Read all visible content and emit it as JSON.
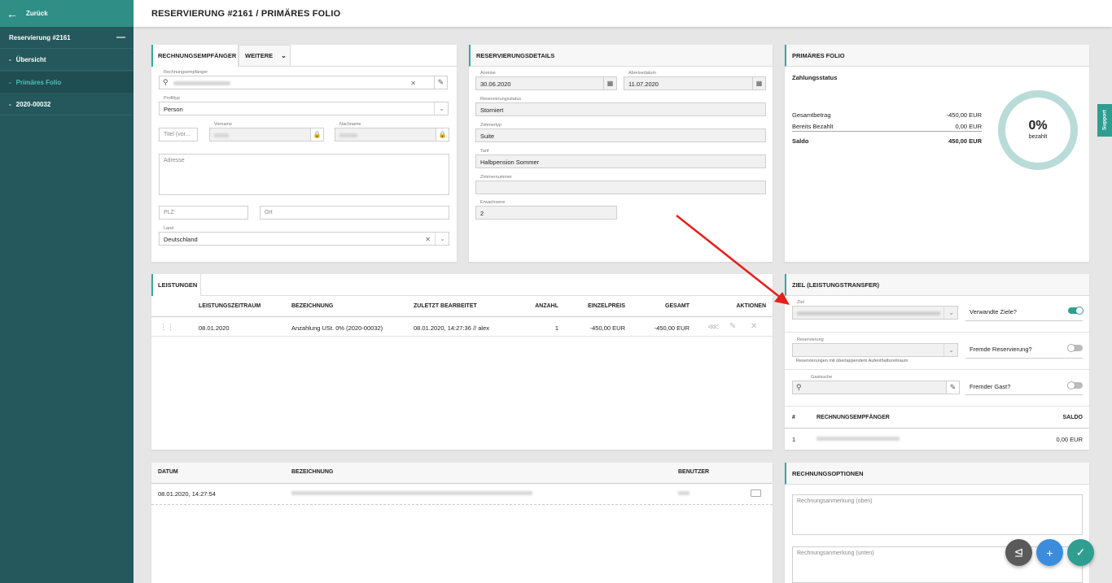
{
  "sidebar": {
    "back_label": "Zurück",
    "section_label": "Reservierung #2161",
    "items": [
      {
        "label": "Übersicht"
      },
      {
        "label": "Primäres Folio"
      },
      {
        "label": "2020-00032"
      }
    ]
  },
  "header": {
    "title": "RESERVIERUNG #2161 / PRIMÄRES FOLIO"
  },
  "recipient": {
    "tab_active": "RECHNUNGSEMPFÄNGER",
    "tab_more": "WEITERE",
    "fields": {
      "rechnungsempfaenger": {
        "label": "Rechnungsempfänger"
      },
      "profiltyp": {
        "label": "Profiltyp",
        "value": "Person"
      },
      "titel": {
        "placeholder": "Titel (vor..."
      },
      "vorname": {
        "label": "Vorname"
      },
      "nachname": {
        "label": "Nachname"
      },
      "adresse": {
        "placeholder": "Adresse"
      },
      "plz": {
        "placeholder": "PLZ"
      },
      "ort": {
        "placeholder": "Ort"
      },
      "land": {
        "label": "Land",
        "value": "Deutschland"
      }
    }
  },
  "details": {
    "title": "RESERVIERUNGSDETAILS",
    "anreise": {
      "label": "Anreise",
      "value": "30.06.2020"
    },
    "abreise": {
      "label": "Abreisedatum",
      "value": "11.07.2020"
    },
    "status": {
      "label": "Reservierungsstatus",
      "value": "Storniert"
    },
    "zimmertyp": {
      "label": "Zimmertyp",
      "value": "Suite"
    },
    "tarif": {
      "label": "Tarif",
      "value": "Halbpension Sommer"
    },
    "zimmernummer": {
      "label": "Zimmernummer",
      "value": ""
    },
    "erwachsene": {
      "label": "Erwachsene",
      "value": "2"
    }
  },
  "folio": {
    "title": "PRIMÄRES FOLIO",
    "subtitle": "Zahlungsstatus",
    "rows": [
      {
        "label": "Gesamtbetrag",
        "value": "-450,00 EUR"
      },
      {
        "label": "Bereits Bezahlt",
        "value": "0,00 EUR"
      },
      {
        "label": "Saldo",
        "value": "450,00 EUR"
      }
    ],
    "percent": "0%",
    "percent_label": "bezahlt"
  },
  "leistungen": {
    "tab": "LEISTUNGEN",
    "columns": [
      "LEISTUNGSZEITRAUM",
      "BEZEICHNUNG",
      "ZULETZT BEARBEITET",
      "ANZAHL",
      "EINZELPREIS",
      "GESAMT",
      "AKTIONEN"
    ],
    "rows": [
      {
        "zeitraum": "08.01.2020",
        "bezeichnung": "Anzahlung USt. 0% (2020-00032)",
        "bearbeitet": "08.01.2020, 14:27:36 // alex",
        "anzahl": "1",
        "einzelpreis": "-450,00 EUR",
        "gesamt": "-450,00 EUR"
      }
    ]
  },
  "log": {
    "columns": [
      "DATUM",
      "BEZEICHNUNG",
      "BENUTZER"
    ],
    "rows": [
      {
        "datum": "08.01.2020, 14:27:54"
      }
    ]
  },
  "ziel": {
    "title": "ZIEL (LEISTUNGSTRANSFER)",
    "ziel_label": "Ziel",
    "verwandte": "Verwandte Ziele?",
    "reservierung_label": "Reservierung",
    "reservierung_hint": "Reservierungen mit überlappendem Aufenthaltszeitraum",
    "fremde_res": "Fremde Reservierung?",
    "gastsuche_label": "Gastsuche",
    "fremder_gast": "Fremder Gast?",
    "columns": [
      "#",
      "RECHNUNGSEMPFÄNGER",
      "SALDO"
    ],
    "rows": [
      {
        "num": "1",
        "saldo": "0,00 EUR"
      }
    ]
  },
  "options": {
    "title": "RECHNUNGSOPTIONEN",
    "oben": "Rechnungsanmerkung (oben)",
    "unten": "Rechnungsanmerkung (unten)"
  },
  "support_label": "Support",
  "colors": {
    "accent": "#3aa89c",
    "sidebar": "#24585c",
    "arrow": "#e5201b",
    "ring": "#b9dcd8"
  }
}
